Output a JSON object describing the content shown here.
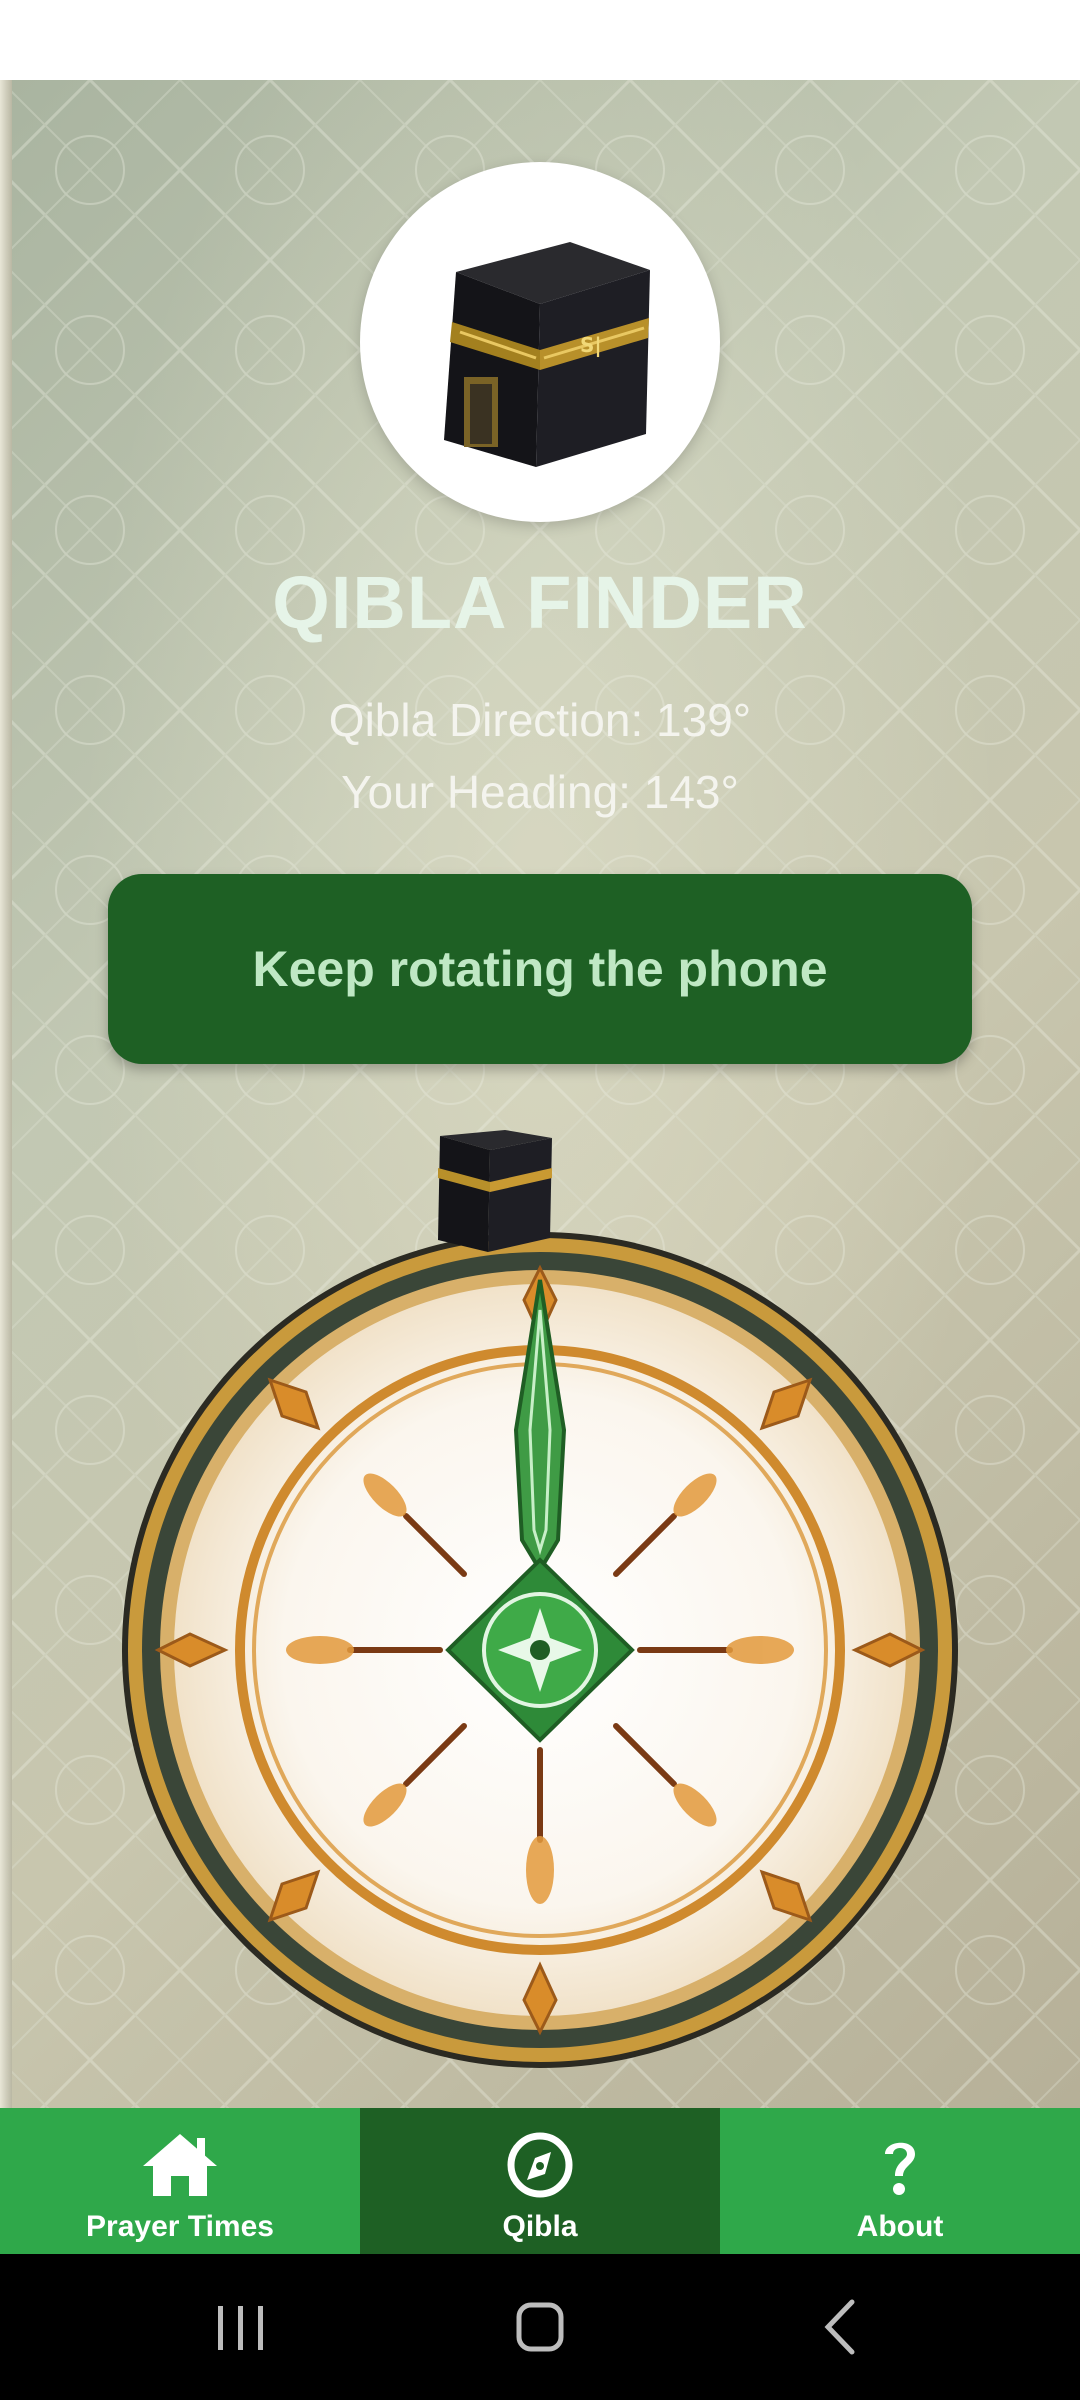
{
  "header": {
    "title": "QIBLA FINDER"
  },
  "qibla": {
    "direction_label": "Qibla Direction: 139°",
    "heading_label": "Your Heading: 143°",
    "direction_degrees": 139,
    "heading_degrees": 143,
    "instruction": "Keep rotating the phone"
  },
  "bottom_nav": {
    "items": [
      {
        "label": "Prayer Times",
        "icon": "home-icon",
        "active": false
      },
      {
        "label": "Qibla",
        "icon": "compass-icon",
        "active": true
      },
      {
        "label": "About",
        "icon": "question-icon",
        "active": false
      }
    ]
  },
  "system_nav": {
    "icons": [
      "recents-icon",
      "home-circle-icon",
      "back-icon"
    ]
  },
  "colors": {
    "nav_green": "#2fa84a",
    "nav_active": "#1e6024",
    "button_green": "#1e6024",
    "title_text": "#e6f4e8"
  }
}
